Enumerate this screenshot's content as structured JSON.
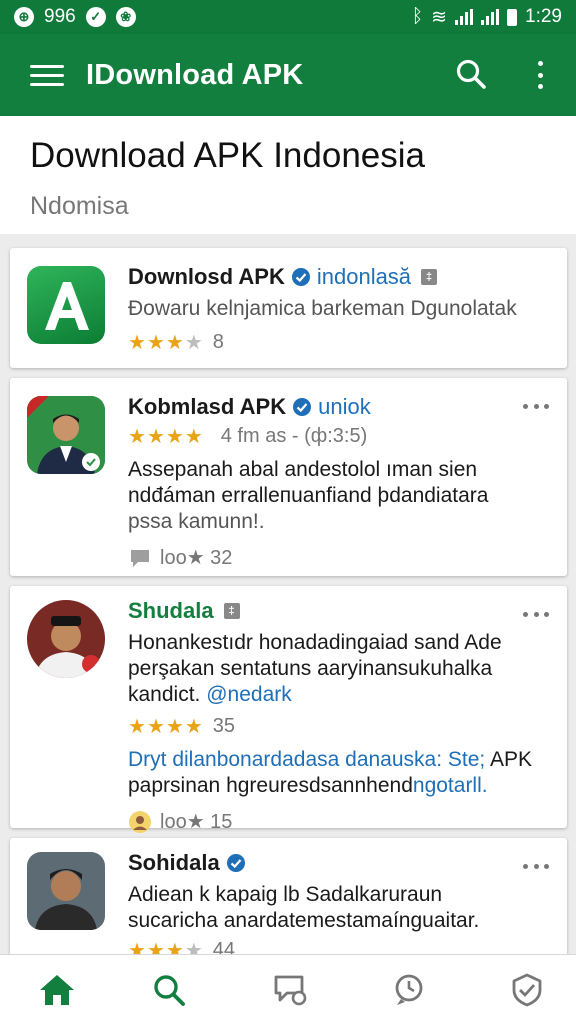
{
  "status_bar": {
    "left_text": "996",
    "time": "1:29"
  },
  "app_bar": {
    "title": "IDownload APK"
  },
  "header": {
    "title": "Download APK Indonesia",
    "subtitle": "Ndomisa"
  },
  "cards": [
    {
      "title": "Downlosd APK",
      "handle": "indonlasă",
      "flag": "‡",
      "description": "Đowaru kelnjamica barkeman Dgunolatak",
      "stars": 3,
      "rating_count": "8"
    },
    {
      "title": "Kobmlasd APK",
      "handle": "uniok",
      "stars": 4,
      "time_label": "4 fm as - (ф:3:5)",
      "lines": [
        "Assepanah abal andestolol ıman sien",
        "ndđáman erralleпuanfiand þdandiatara",
        "pssa kamunn!."
      ],
      "meta_text": "loo★ 32"
    },
    {
      "title": "Shudala",
      "flag": "‡",
      "lines": [
        "Honankestıdr honadadingaiad sand Ade",
        "perşakan sentatuns aaryinansukuhalka"
      ],
      "line3": "kandict.",
      "line3_link": "@nedark",
      "stars": 4,
      "rating_count": "35",
      "link_line": "Dryt dilanbonardadasa danauska: Ste;",
      "link_line_suffix": "APK",
      "line_after": "paprsinan hgreuresdsannhend",
      "line_after_link": "ngotarll.",
      "meta_text": "loo★ 15"
    },
    {
      "title": "Sohidala",
      "lines": [
        "Adiean k kapaig lb Sadalkaruraun",
        "sucaricha anardatemestamaínguaitar."
      ],
      "stars": 3,
      "rating_count": "44"
    }
  ],
  "bottom_nav": [
    "home",
    "search",
    "chat",
    "support",
    "verified"
  ],
  "colors": {
    "primary": "#137f3f",
    "link": "#1f6fb8",
    "star": "#e8a317"
  }
}
